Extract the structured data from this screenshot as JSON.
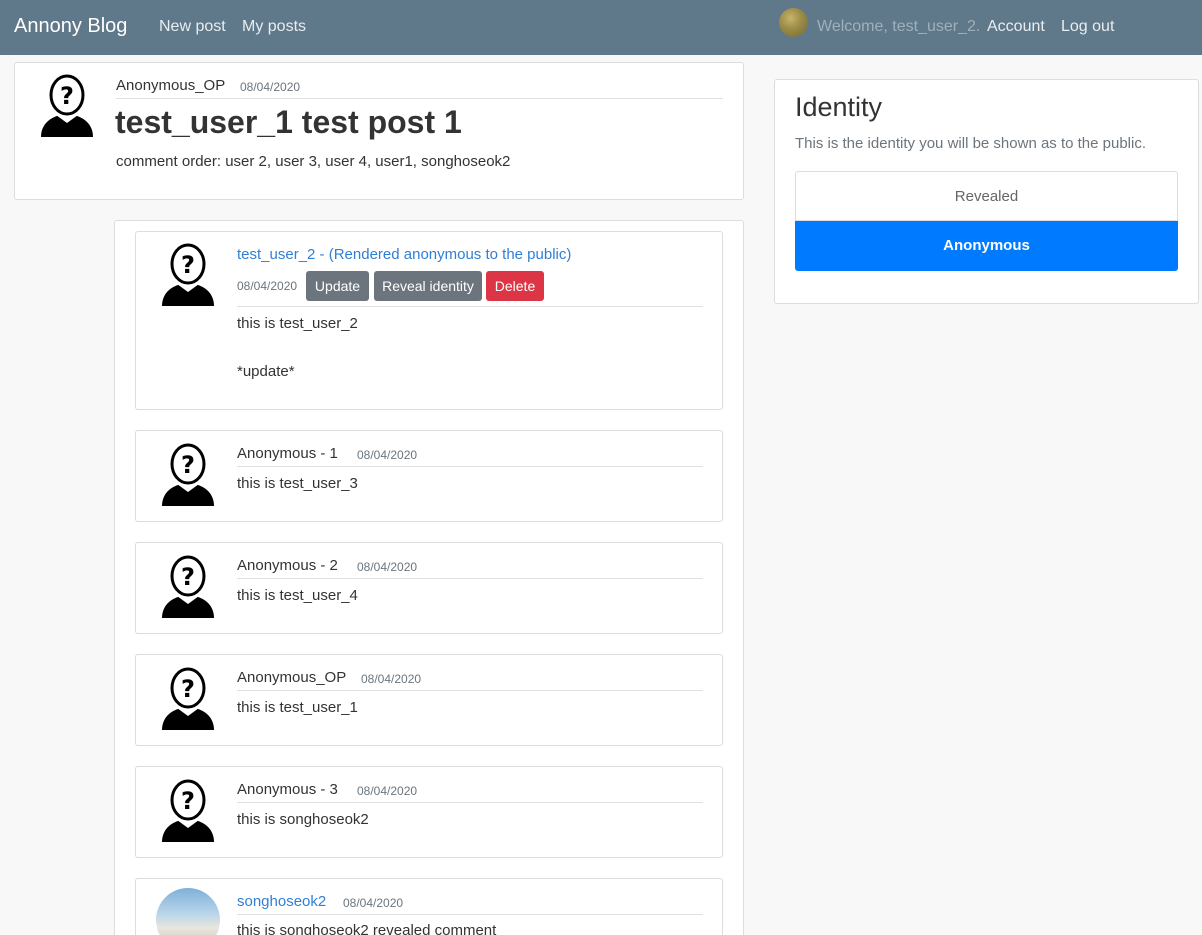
{
  "nav": {
    "brand": "Annony Blog",
    "new_post": "New post",
    "my_posts": "My posts",
    "welcome": "Welcome, test_user_2.",
    "account": "Account",
    "logout": "Log out"
  },
  "post": {
    "author": "Anonymous_OP",
    "date": "08/04/2020",
    "title": "test_user_1 test post 1",
    "body": "comment order: user 2, user 3, user 4, user1, songhoseok2"
  },
  "comments": [
    {
      "author": "test_user_2 - (Rendered anonymous to the public)",
      "date": "08/04/2020",
      "line1": "this is test_user_2",
      "line2": "*update*",
      "update_label": "Update",
      "reveal_label": "Reveal identity",
      "delete_label": "Delete"
    },
    {
      "author": "Anonymous - 1",
      "date": "08/04/2020",
      "text": "this is test_user_3"
    },
    {
      "author": "Anonymous - 2",
      "date": "08/04/2020",
      "text": "this is test_user_4"
    },
    {
      "author": "Anonymous_OP",
      "date": "08/04/2020",
      "text": "this is test_user_1"
    },
    {
      "author": "Anonymous - 3",
      "date": "08/04/2020",
      "text": "this is songhoseok2"
    },
    {
      "author": "songhoseok2",
      "date": "08/04/2020",
      "text": "this is songhoseok2 revealed comment"
    }
  ],
  "identity": {
    "title": "Identity",
    "description": "This is the identity you will be shown as to the public.",
    "revealed_label": "Revealed",
    "anonymous_label": "Anonymous"
  },
  "colors": {
    "navbar": "#5f788a",
    "primary": "#007bff",
    "secondary": "#6c757d",
    "danger": "#dc3545",
    "link": "#2f7fd6"
  },
  "icons": {
    "anonymous_avatar": "anonymous-avatar-icon",
    "user_avatar": "user-avatar-icon"
  }
}
